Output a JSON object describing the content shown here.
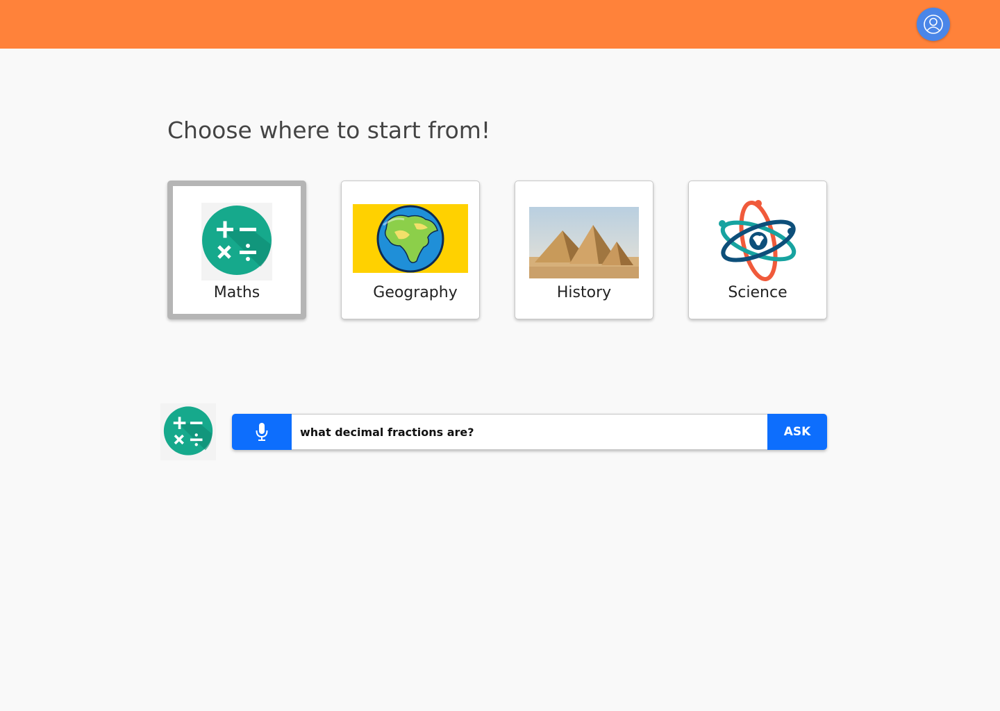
{
  "header": {
    "avatar_icon": "user-circle-icon",
    "bg_color": "#ff823a"
  },
  "main": {
    "heading": "Choose where to start from!",
    "subjects": [
      {
        "label": "Maths",
        "icon": "math-operations-icon",
        "selected": true
      },
      {
        "label": "Geography",
        "icon": "globe-icon",
        "selected": false
      },
      {
        "label": "History",
        "icon": "pyramids-image",
        "selected": false
      },
      {
        "label": "Science",
        "icon": "atom-globe-icon",
        "selected": false
      }
    ]
  },
  "ask": {
    "subject_icon": "math-operations-icon",
    "mic_icon": "microphone-icon",
    "query": "what decimal fractions are?",
    "button_label": "ASK",
    "accent_color": "#0d6efd"
  }
}
